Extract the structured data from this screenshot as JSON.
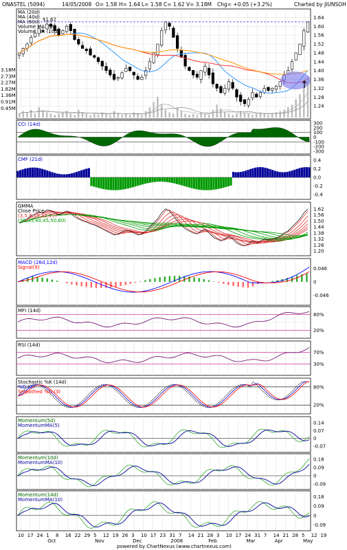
{
  "header": {
    "symbol": "ONASTEL (5094)",
    "date": "14/05/2008",
    "open": "O= 1.58",
    "high": "H= 1.64",
    "low": "L= 1.58",
    "close": "C= 1.62",
    "volume": "V= 3.18M",
    "change": "Chg= +0.05 (+3.2%)",
    "credit": "Charted by JIUNSOH"
  },
  "footer": "powered by ChartNexus (www.chartnexus.com)",
  "colors": {
    "ma20": "#3399ff",
    "ma40": "#ff3333",
    "ma60": "#ff9900",
    "up": "#ffffff",
    "down": "#000000",
    "cci_fill": "#006600",
    "cmf_pos": "#000099",
    "cmf_neg": "#009900",
    "macd": "#0000ff",
    "signal": "#ff0000",
    "hist_up": "#33aa33",
    "hist_down": "#ff6666",
    "band": "#cc3399",
    "mom": "#33aa33",
    "mom_ma": "#000099"
  },
  "price_panel": {
    "legend": [
      "MA (20d)",
      "MA (40d)",
      "MA (60d)",
      "Volume MA (5d)",
      "Volume MA (10d)"
    ],
    "high_marker": "$1.62",
    "y_ticks": [
      "1.64",
      "1.60",
      "1.56",
      "1.52",
      "1.48",
      "1.44",
      "1.40",
      "1.36",
      "1.32",
      "1.28",
      "1.24"
    ],
    "vol_ticks": [
      "3.18M",
      "2.73M",
      "2.27M",
      "1.82M",
      "1.36M",
      "0.91M",
      "0.45M"
    ]
  },
  "x_axis": {
    "days": [
      "10",
      "17",
      "24",
      "1",
      "8",
      "16",
      "22",
      "29",
      "5",
      "12",
      "19",
      "26",
      "3",
      "10",
      "17",
      "23",
      "31",
      "7",
      "14",
      "21",
      "28",
      "3",
      "10",
      "17",
      "24",
      "31",
      "7",
      "14",
      "21",
      "28",
      "5",
      "12",
      "19",
      "26"
    ],
    "months": [
      {
        "label": "Oct",
        "at": 3
      },
      {
        "label": "Nov",
        "at": 8
      },
      {
        "label": "Dec",
        "at": 12
      },
      {
        "label": "2008",
        "at": 16
      },
      {
        "label": "Feb",
        "at": 20
      },
      {
        "label": "Mar",
        "at": 24
      },
      {
        "label": "Apr",
        "at": 27
      },
      {
        "label": "May",
        "at": 30
      }
    ]
  },
  "indicators": {
    "cci": {
      "title": "CCI (14d)",
      "ticks": [
        "300",
        "200",
        "100",
        "0",
        "-100",
        "-200",
        "-300"
      ]
    },
    "cmf": {
      "title": "CMF (21d)",
      "ticks": [
        "0.4",
        "0.2",
        "0.0",
        "-0.2",
        "-0.4"
      ]
    },
    "gmma": {
      "title": "GMMA",
      "sub1": "Close Price",
      "sub2": "(3,5,8,10,12,15)",
      "sub3": "(30,35,40,45,50,60)",
      "ticks": [
        "1.62",
        "1.56",
        "1.50",
        "1.44",
        "1.38",
        "1.32",
        "1.26",
        "1.20"
      ]
    },
    "macd": {
      "title": "MACD (26d,12d)",
      "sub": "Signal(9)",
      "ticks": [
        "0.046",
        "0",
        "-0.046"
      ]
    },
    "mfi": {
      "title": "MFI (14d)",
      "ticks": [
        "80%",
        "20%"
      ]
    },
    "rsi": {
      "title": "RSI (14d)",
      "ticks": [
        "70%",
        "30%"
      ]
    },
    "stoch": {
      "title": "Stochastic %K (14d)",
      "sub1": "%D (3)",
      "sub2": "Smoothed %D (3)",
      "ticks": [
        "80%",
        "20%"
      ]
    },
    "mom5": {
      "title": "Momentum(5d)",
      "sub": "MomentumMA(5)",
      "ticks": [
        "0.14",
        "0.07",
        "0",
        "-0.07"
      ]
    },
    "mom10": {
      "title": "Momentum(10d)",
      "sub": "MomentumMA(10)",
      "ticks": [
        "0.18",
        "0.09",
        "0",
        "-0.09"
      ]
    },
    "mom14": {
      "title": "Momentum(14d)",
      "sub": "MomentumMA(10)",
      "ticks": [
        "0.18",
        "0.09",
        "0",
        "-0.09"
      ]
    }
  },
  "chart_data": {
    "type": "candlestick",
    "title": "ONASTEL (5094)",
    "ylim": [
      1.2,
      1.66
    ],
    "close_path": [
      1.48,
      1.5,
      1.52,
      1.55,
      1.57,
      1.59,
      1.58,
      1.61,
      1.6,
      1.58,
      1.56,
      1.58,
      1.6,
      1.58,
      1.54,
      1.52,
      1.5,
      1.49,
      1.47,
      1.46,
      1.44,
      1.42,
      1.4,
      1.38,
      1.36,
      1.37,
      1.39,
      1.41,
      1.4,
      1.38,
      1.36,
      1.37,
      1.4,
      1.44,
      1.48,
      1.52,
      1.58,
      1.62,
      1.6,
      1.55,
      1.5,
      1.46,
      1.42,
      1.4,
      1.38,
      1.37,
      1.4,
      1.42,
      1.38,
      1.34,
      1.32,
      1.3,
      1.32,
      1.35,
      1.32,
      1.28,
      1.26,
      1.25,
      1.27,
      1.3,
      1.28,
      1.3,
      1.32,
      1.31,
      1.32,
      1.33,
      1.35,
      1.38,
      1.4,
      1.44,
      1.48,
      1.52,
      1.58,
      1.62
    ],
    "volume": [
      0.3,
      0.5,
      0.4,
      0.6,
      0.3,
      0.8,
      0.5,
      0.4,
      0.3,
      0.2,
      0.3,
      0.4,
      0.5,
      0.3,
      0.2,
      0.6,
      0.4,
      0.3,
      0.2,
      0.3,
      0.2,
      0.4,
      0.3,
      0.2,
      0.5,
      0.3,
      0.2,
      0.3,
      0.2,
      0.4,
      0.3,
      0.2,
      0.5,
      0.8,
      1.2,
      1.6,
      1.0,
      0.6,
      0.4,
      0.3,
      0.8,
      0.5,
      0.3,
      0.2,
      0.3,
      0.2,
      0.4,
      0.3,
      0.2,
      0.6,
      1.0,
      0.7,
      0.4,
      0.3,
      0.2,
      0.3,
      0.5,
      0.4,
      0.3,
      0.2,
      0.3,
      0.4,
      0.3,
      0.2,
      0.3,
      0.4,
      0.5,
      0.6,
      0.8,
      1.0,
      1.4,
      1.8,
      2.4,
      3.18
    ]
  }
}
